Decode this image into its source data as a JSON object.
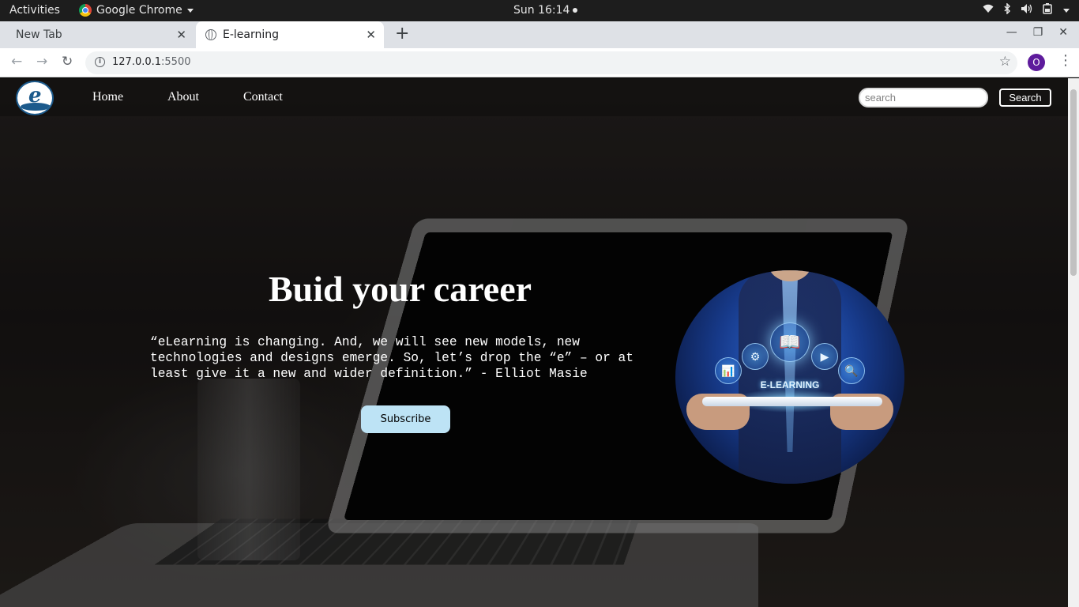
{
  "system_bar": {
    "activities": "Activities",
    "app_name": "Google Chrome",
    "clock": "Sun 16:14",
    "tray_icons": [
      "wifi-icon",
      "bluetooth-icon",
      "volume-icon",
      "battery-icon",
      "chevron-down-icon"
    ]
  },
  "browser": {
    "tabs": [
      {
        "label": "New Tab",
        "active": false
      },
      {
        "label": "E-learning",
        "active": true
      }
    ],
    "url_host": "127.0.0.1",
    "url_port": ":5500",
    "profile_initial": "O"
  },
  "site": {
    "nav": {
      "links": [
        "Home",
        "About",
        "Contact"
      ]
    },
    "search": {
      "placeholder": "search",
      "button_label": "Search"
    },
    "hero": {
      "title": "Buid your career",
      "quote": "“eLearning is changing. And, we will see new models, new technologies and designs emerge. So, let’s drop the “e” – or at least give it a new and wider definition.” - Elliot Masie",
      "cta_label": "Subscribe"
    },
    "illustration": {
      "label": "E-LEARNING"
    }
  },
  "colors": {
    "subscribe_bg": "#bde3f5",
    "profile_bg": "#5e1b9c"
  }
}
